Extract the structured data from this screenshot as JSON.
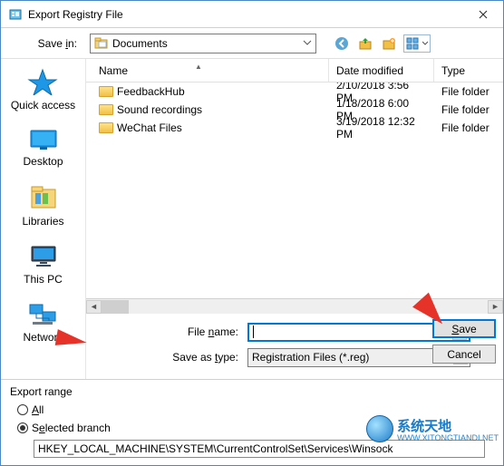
{
  "title": "Export Registry File",
  "save_in_label": "Save in:",
  "location": {
    "name": "Documents"
  },
  "toolbar": {
    "back": "back-icon",
    "up": "up-one-level-icon",
    "new": "new-folder-icon",
    "views": "views-icon"
  },
  "columns": {
    "name": "Name",
    "date": "Date modified",
    "type": "Type"
  },
  "files": [
    {
      "name": "FeedbackHub",
      "date": "2/10/2018 3:56 PM",
      "type": "File folder"
    },
    {
      "name": "Sound recordings",
      "date": "1/18/2018 6:00 PM",
      "type": "File folder"
    },
    {
      "name": "WeChat Files",
      "date": "3/19/2018 12:32 PM",
      "type": "File folder"
    }
  ],
  "places": [
    {
      "label": "Quick access"
    },
    {
      "label": "Desktop"
    },
    {
      "label": "Libraries"
    },
    {
      "label": "This PC"
    },
    {
      "label": "Network"
    }
  ],
  "file_name_label_pre": "File ",
  "file_name_label_ul": "n",
  "file_name_label_post": "ame:",
  "file_name_value": "",
  "save_type_label_pre": "Save as ",
  "save_type_label_ul": "t",
  "save_type_label_post": "ype:",
  "save_type_value": "Registration Files (*.reg)",
  "save_btn_ul": "S",
  "save_btn_post": "ave",
  "cancel_btn": "Cancel",
  "export_range_label": "Export range",
  "radio_all_ul": "A",
  "radio_all_post": "ll",
  "radio_sel_pre": "S",
  "radio_sel_ul": "e",
  "radio_sel_post": "lected branch",
  "branch_path": "HKEY_LOCAL_MACHINE\\SYSTEM\\CurrentControlSet\\Services\\Winsock",
  "watermark": {
    "line1": "系统天地",
    "line2": "WWW.XITONGTIANDI.NET"
  }
}
